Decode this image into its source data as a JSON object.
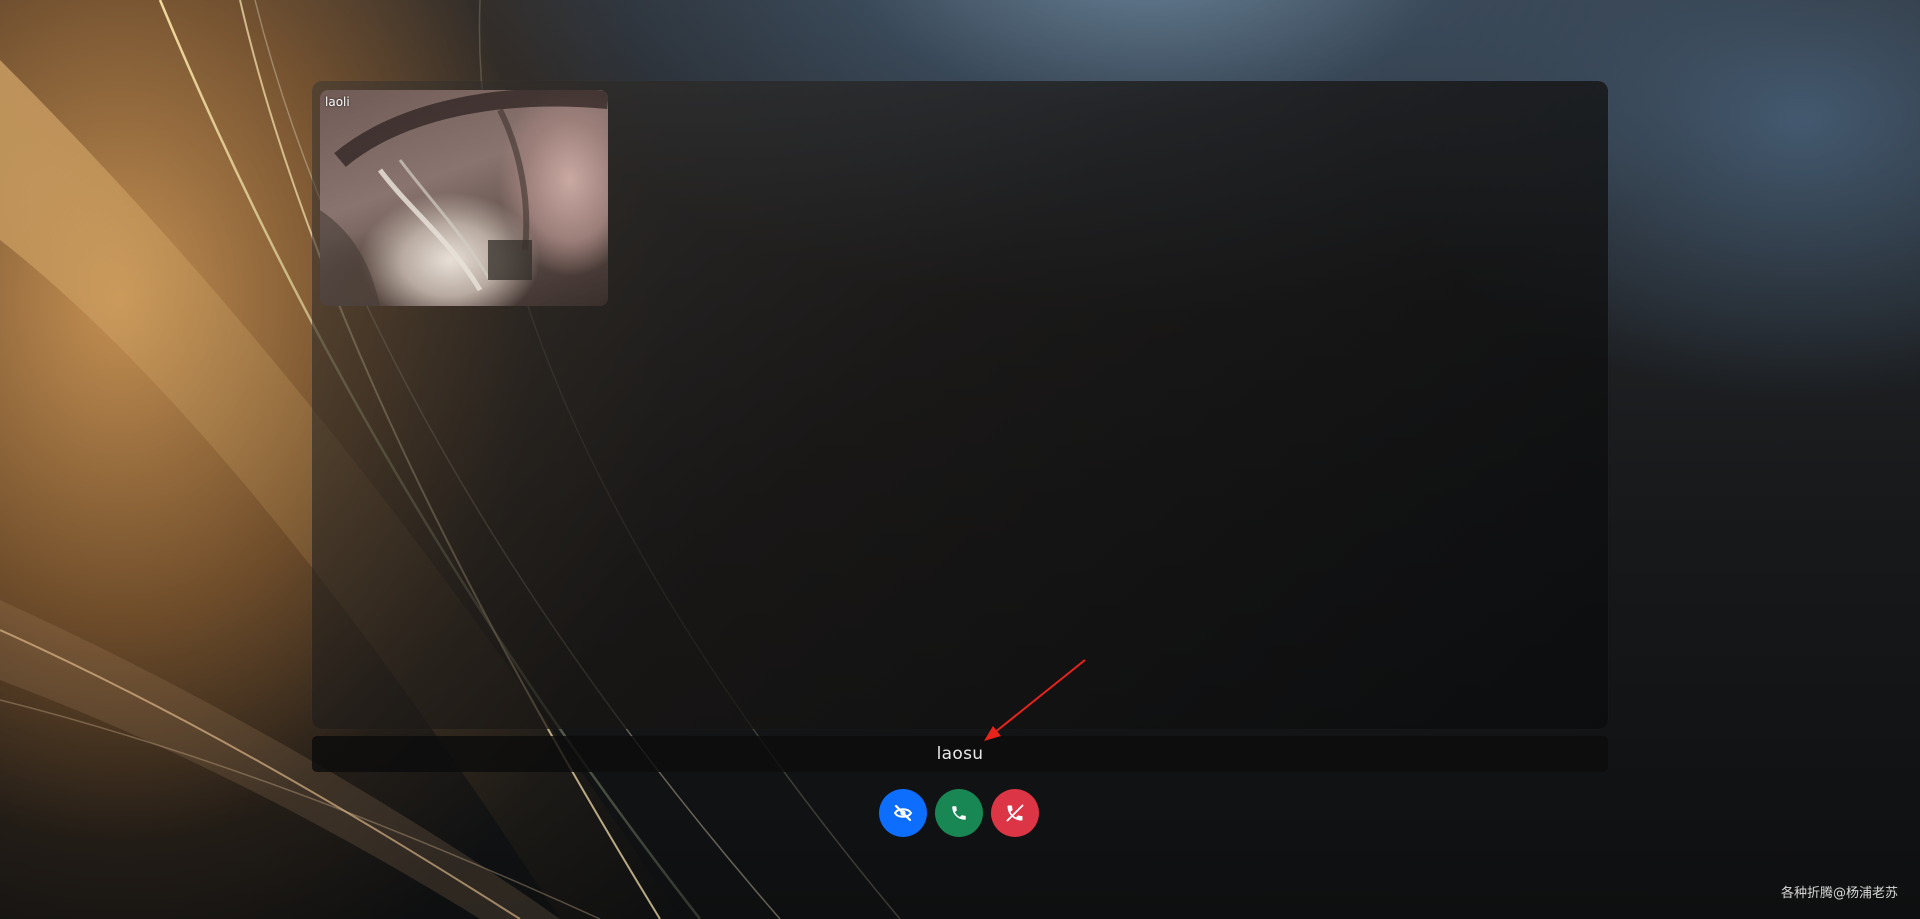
{
  "local_video": {
    "label": "laoli"
  },
  "remote_user": {
    "name": "laosu"
  },
  "controls": [
    {
      "name": "toggle-video-button",
      "icon": "eye-slash-icon",
      "color": "#0d6efd"
    },
    {
      "name": "answer-call-button",
      "icon": "phone-icon",
      "color": "#198754"
    },
    {
      "name": "hangup-call-button",
      "icon": "phone-hangup-icon",
      "color": "#dc3545"
    }
  ],
  "annotation": {
    "icon": "red-arrow-icon",
    "color": "#e8231b"
  },
  "watermark": {
    "text": "各种折腾@杨浦老苏"
  }
}
